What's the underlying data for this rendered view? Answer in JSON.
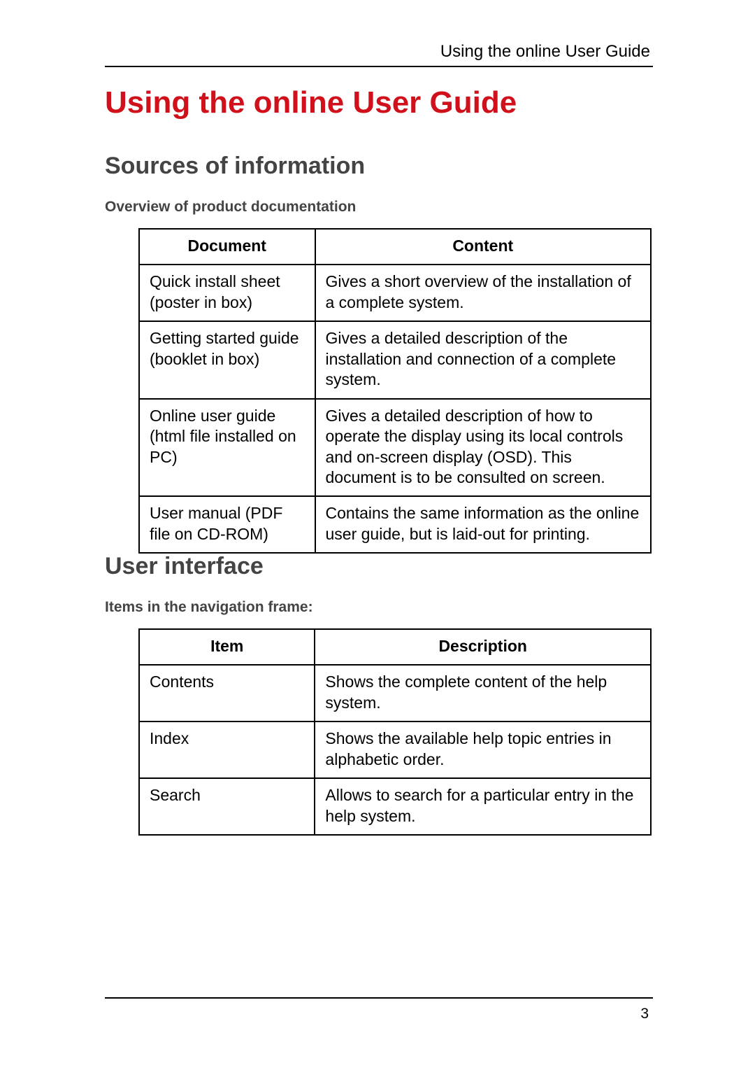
{
  "running_head": "Using the online User Guide",
  "main_title": "Using the online User Guide",
  "section1": {
    "title": "Sources of information",
    "sub": "Overview of product documentation",
    "head": {
      "c1": "Document",
      "c2": "Content"
    },
    "rows": [
      {
        "c1": "Quick install sheet (poster in box)",
        "c2": "Gives a short overview of the installation of a complete system."
      },
      {
        "c1": "Getting started guide (booklet in box)",
        "c2": "Gives a detailed description of the installation and connection of a complete system."
      },
      {
        "c1": "Online user guide (html file installed on PC)",
        "c2": "Gives a detailed description of how to operate the display using its local controls and on-screen display (OSD). This document is to be consulted on screen."
      },
      {
        "c1": "User manual (PDF file on CD-ROM)",
        "c2": "Contains the same information as the online user guide, but is laid-out for printing."
      }
    ]
  },
  "section2": {
    "title": "User interface",
    "sub": "Items in the navigation frame:",
    "head": {
      "c1": "Item",
      "c2": "Description"
    },
    "rows": [
      {
        "c1": "Contents",
        "c2": "Shows the complete content of the help system."
      },
      {
        "c1": "Index",
        "c2": "Shows the available help topic entries in alphabetic order."
      },
      {
        "c1": "Search",
        "c2": "Allows to search for a particular entry in the help system."
      }
    ]
  },
  "folio": "3"
}
